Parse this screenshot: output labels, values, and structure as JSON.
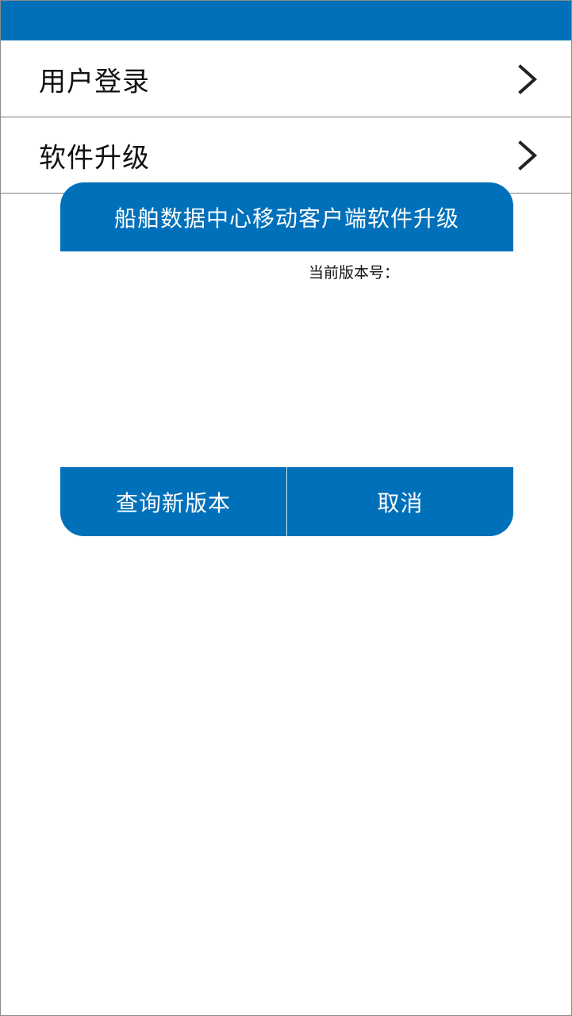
{
  "colors": {
    "primary": "#0070BA",
    "background": "#FFFFFF",
    "text": "#111111"
  },
  "menu": {
    "items": [
      {
        "label": "用户登录",
        "icon": "chevron-right-icon"
      },
      {
        "label": "软件升级",
        "icon": "chevron-right-icon"
      }
    ]
  },
  "dialog": {
    "title": "船舶数据中心移动客户端软件升级",
    "version_label": "当前版本号：",
    "buttons": {
      "check_label": "查询新版本",
      "cancel_label": "取消"
    }
  }
}
